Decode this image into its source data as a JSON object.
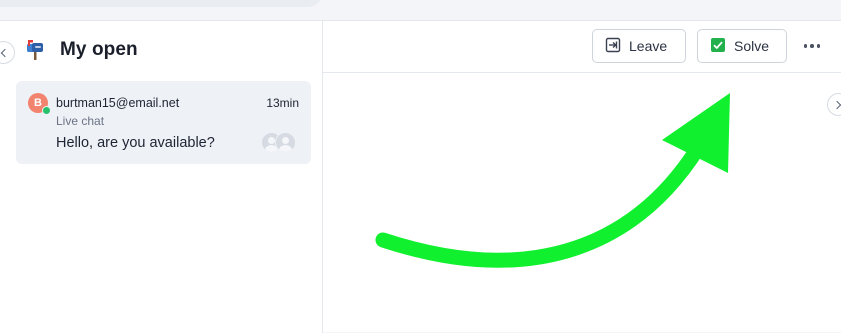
{
  "sidebar": {
    "title": "My open",
    "title_icon": "mailbox-icon",
    "conversations": [
      {
        "avatar_initial": "B",
        "email": "burtman15@email.net",
        "time": "13min",
        "channel": "Live chat",
        "message": "Hello, are you available?"
      }
    ]
  },
  "toolbar": {
    "leave_label": "Leave",
    "solve_label": "Solve",
    "more_icon": "more-horizontal-icon"
  },
  "colors": {
    "arrow": "#11f02f",
    "avatar": "#f2836f",
    "online": "#25c26b",
    "solve_check": "#22b14c"
  }
}
